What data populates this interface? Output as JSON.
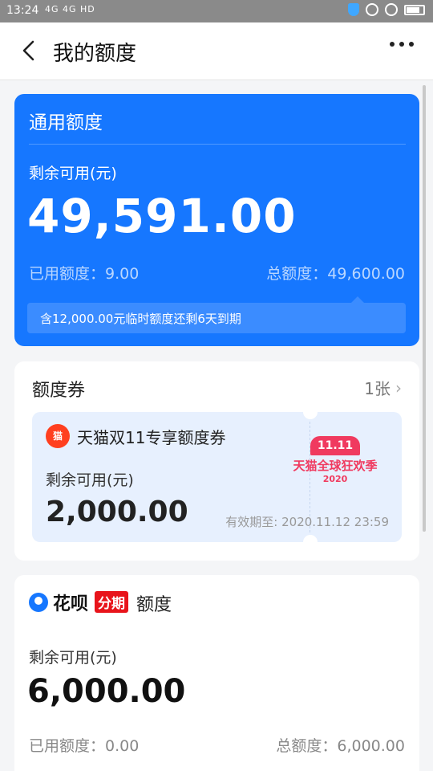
{
  "status_bar": {
    "time": "13:24",
    "signal": "4G 4G HD"
  },
  "header": {
    "title": "我的额度"
  },
  "general_quota": {
    "title": "通用额度",
    "available_label": "剩余可用(元)",
    "available_amount": "49,591.00",
    "used": "已用额度：9.00",
    "total": "总额度：49,600.00",
    "note": "含12,000.00元临时额度还剩6天到期"
  },
  "coupons": {
    "title": "额度券",
    "count": "1张",
    "coupon": {
      "logo": "猫",
      "name": "天猫双11专享额度券",
      "available_label": "剩余可用(元)",
      "amount": "2,000.00",
      "expiry": "有效期至: 2020.11.12 23:59",
      "badge_top": "11.11",
      "badge_text": "天猫全球狂欢季",
      "badge_year": "2020"
    }
  },
  "huabei_installment": {
    "brand": "花呗",
    "tag": "分期",
    "title": "额度",
    "available_label": "剩余可用(元)",
    "amount": "6,000.00",
    "used": "已用额度：0.00",
    "total": "总额度：6,000.00"
  },
  "colors": {
    "primary_blue": "#1677ff",
    "tmall_red": "#ff3f1f",
    "huabei_red": "#e8141b"
  }
}
